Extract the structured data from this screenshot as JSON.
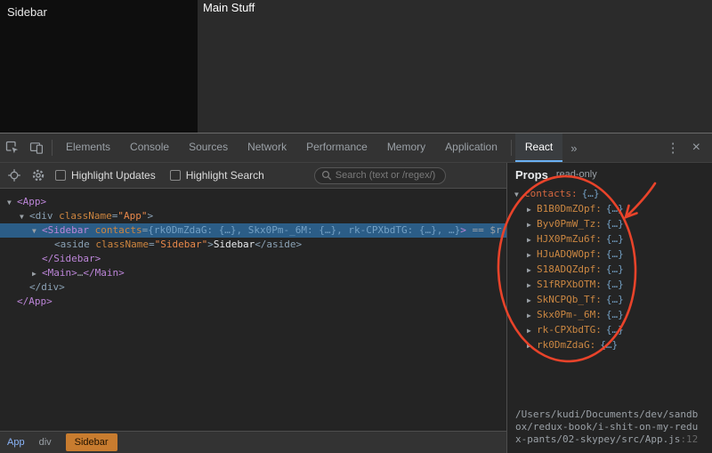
{
  "colors": {
    "devtools_bg": "#242424",
    "toolbar_bg": "#333333",
    "divider": "#4d4d4d",
    "tab_text": "#9aa0a6",
    "tab_selected_text": "#ffffff",
    "tab_accent": "#6ab0f3",
    "selection_bg": "#2b5d87",
    "comp_tag": "#bc85d8",
    "dom_tag": "#8aa1b4",
    "attr_name": "#cd853f",
    "string_value": "#e8884a",
    "object_value": "#74a0c4",
    "plain_text": "#e8eaed",
    "muted_text": "#9aa0a6",
    "prop_key": "#cb8742",
    "contacts_key": "#d3673f",
    "breadcrumb_comp": "#8ab4f8",
    "breadcrumb_selected_bg": "#c87c2f",
    "annotation_red": "#e8432a",
    "page_sidebar_bg": "#0e0e0e",
    "page_main_bg": "#2b2b2b"
  },
  "page": {
    "sidebar_label": "Sidebar",
    "main_label": "Main Stuff"
  },
  "devtools": {
    "tabs": [
      {
        "label": "Elements"
      },
      {
        "label": "Console"
      },
      {
        "label": "Sources"
      },
      {
        "label": "Network"
      },
      {
        "label": "Performance"
      },
      {
        "label": "Memory"
      },
      {
        "label": "Application"
      },
      {
        "label": "React",
        "selected": true,
        "divider_before": true
      }
    ],
    "more_tabs": "»",
    "window_controls": {
      "menu": "⋮",
      "close": "×"
    },
    "toolbar": {
      "highlight_updates": "Highlight Updates",
      "highlight_search": "Highlight Search",
      "search_placeholder": "Search (text or /regex/)"
    },
    "tree": {
      "rows": [
        {
          "indent": 0,
          "arrow": "▼",
          "selected": false,
          "segments": [
            {
              "t": "<App>",
              "c": "comp"
            }
          ]
        },
        {
          "indent": 1,
          "arrow": "▼",
          "selected": false,
          "segments": [
            {
              "t": "<div ",
              "c": "dom"
            },
            {
              "t": "className",
              "c": "attr"
            },
            {
              "t": "=",
              "c": "dom"
            },
            {
              "t": "\"App\"",
              "c": "str"
            },
            {
              "t": ">",
              "c": "dom"
            }
          ]
        },
        {
          "indent": 2,
          "arrow": "▼",
          "selected": true,
          "segments": [
            {
              "t": "<Sidebar ",
              "c": "comp"
            },
            {
              "t": "contacts",
              "c": "attr"
            },
            {
              "t": "=",
              "c": "dom"
            },
            {
              "t": "{rk0DmZdaG: {…}, Skx0Pm-_6M: {…}, rk-CPXbdTG: {…}, …}",
              "c": "obj"
            },
            {
              "t": ">",
              "c": "comp"
            },
            {
              "t": " == $r",
              "c": "ref"
            }
          ]
        },
        {
          "indent": 3,
          "arrow": "",
          "selected": false,
          "segments": [
            {
              "t": "<aside ",
              "c": "dom"
            },
            {
              "t": "className",
              "c": "attr"
            },
            {
              "t": "=",
              "c": "dom"
            },
            {
              "t": "\"Sidebar\"",
              "c": "str"
            },
            {
              "t": ">",
              "c": "dom"
            },
            {
              "t": "Sidebar",
              "c": "text"
            },
            {
              "t": "</aside>",
              "c": "dom"
            }
          ]
        },
        {
          "indent": 2,
          "arrow": "",
          "selected": false,
          "segments": [
            {
              "t": "</Sidebar>",
              "c": "comp"
            }
          ]
        },
        {
          "indent": 2,
          "arrow": "▶",
          "selected": false,
          "segments": [
            {
              "t": "<Main>",
              "c": "comp"
            },
            {
              "t": "…",
              "c": "ref"
            },
            {
              "t": "</Main>",
              "c": "comp"
            }
          ]
        },
        {
          "indent": 1,
          "arrow": "",
          "selected": false,
          "segments": [
            {
              "t": "</div>",
              "c": "dom"
            }
          ]
        },
        {
          "indent": 0,
          "arrow": "",
          "selected": false,
          "segments": [
            {
              "t": "</App>",
              "c": "comp"
            }
          ]
        }
      ]
    },
    "props_panel": {
      "title": "Props",
      "subtitle": "read-only",
      "root": {
        "arrow": "▼",
        "key_label": "contacts:",
        "value": "{…}"
      },
      "entries": [
        {
          "arrow": "▶",
          "key_label": "B1B0DmZOpf:",
          "value": "{…}"
        },
        {
          "arrow": "▶",
          "key_label": "Byv0PmW_Tz:",
          "value": "{…}"
        },
        {
          "arrow": "▶",
          "key_label": "HJX0PmZu6f:",
          "value": "{…}"
        },
        {
          "arrow": "▶",
          "key_label": "HJuADQWOpf:",
          "value": "{…}"
        },
        {
          "arrow": "▶",
          "key_label": "S18ADQZdpf:",
          "value": "{…}"
        },
        {
          "arrow": "▶",
          "key_label": "S1fRPXbOTM:",
          "value": "{…}"
        },
        {
          "arrow": "▶",
          "key_label": "SkNCPQb_Tf:",
          "value": "{…}"
        },
        {
          "arrow": "▶",
          "key_label": "Skx0Pm-_6M:",
          "value": "{…}"
        },
        {
          "arrow": "▶",
          "key_label": "rk-CPXbdTG:",
          "value": "{…}"
        },
        {
          "arrow": "▶",
          "key_label": "rk0DmZdaG:",
          "value": "{…}"
        }
      ],
      "source_path": "/Users/kudi/Documents/dev/sandbox/redux-book/i-shit-on-my-redux-pants/02-skypey/src/App.js",
      "source_line": ":12"
    },
    "breadcrumbs": [
      {
        "label": "App",
        "kind": "component",
        "selected": false
      },
      {
        "label": "div",
        "kind": "dom",
        "selected": false
      },
      {
        "label": "Sidebar",
        "kind": "component",
        "selected": true
      }
    ],
    "annotation": {
      "shapes": [
        "oval",
        "arrow"
      ],
      "color": "#e8432a"
    }
  }
}
